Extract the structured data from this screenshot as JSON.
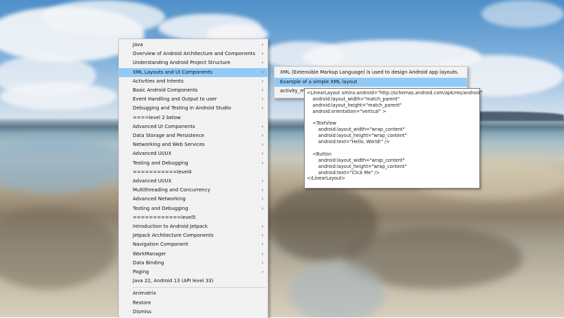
{
  "main_menu": {
    "items": [
      {
        "label": "Java",
        "arrow": true
      },
      {
        "label": "Overview of Android Architecture and Components",
        "arrow": true
      },
      {
        "label": "Understanding Android Project Structure",
        "arrow": true
      },
      {
        "label": "XML Layouts and UI Components",
        "arrow": true,
        "highlighted": true
      },
      {
        "label": "Activities and Intents",
        "arrow": true
      },
      {
        "label": "Basic Android Components",
        "arrow": true
      },
      {
        "label": "Event Handling and Output to user",
        "arrow": true
      },
      {
        "label": "Debugging and Testing in Android Studio",
        "arrow": true
      },
      {
        "label": "====level 2 below",
        "arrow": false
      },
      {
        "label": "Advanced UI Components",
        "arrow": true
      },
      {
        "label": "Data Storage and Persistence",
        "arrow": true
      },
      {
        "label": "Networking and Web Services",
        "arrow": true
      },
      {
        "label": "Advanced UI/UX",
        "arrow": true
      },
      {
        "label": "Testing and Debugging",
        "arrow": true
      },
      {
        "label": "===========level4",
        "arrow": false
      },
      {
        "label": "Advanced UI/UX",
        "arrow": true
      },
      {
        "label": "Multithreading and Concurrency",
        "arrow": true
      },
      {
        "label": "Advanced Networking",
        "arrow": true
      },
      {
        "label": "Testing and Debugging",
        "arrow": true
      },
      {
        "label": "============level5",
        "arrow": false
      },
      {
        "label": "Introduction to Android Jetpack",
        "arrow": true
      },
      {
        "label": "Jetpack Architecture Components",
        "arrow": true
      },
      {
        "label": "Navigation Component",
        "arrow": true
      },
      {
        "label": "WorkManager",
        "arrow": true
      },
      {
        "label": "Data Binding",
        "arrow": true
      },
      {
        "label": "Paging",
        "arrow": true
      },
      {
        "label": "Java 22, Android 13 (API level 33)",
        "arrow": false
      }
    ],
    "footer_items": [
      {
        "label": "Animatrix"
      },
      {
        "label": "Restore"
      },
      {
        "label": "Dismiss"
      }
    ]
  },
  "sub_menu": {
    "items": [
      {
        "label": "XML (Extensible Markup Language) is used to design Android app layouts.",
        "highlighted": false
      },
      {
        "label": "Example of a simple XML layout",
        "highlighted": true
      },
      {
        "label": "activity_ma",
        "highlighted": false
      }
    ]
  },
  "tooltip": {
    "lines": [
      "<LinearLayout xmlns:android=\"http://schemas.android.com/apk/res/android\"",
      "    android:layout_width=\"match_parent\"",
      "    android:layout_height=\"match_parent\"",
      "    android:orientation=\"vertical\" >",
      "",
      "    <TextView",
      "        android:layout_width=\"wrap_content\"",
      "        android:layout_height=\"wrap_content\"",
      "        android:text=\"Hello, World!\" />",
      "",
      "    <Button",
      "        android:layout_width=\"wrap_content\"",
      "        android:layout_height=\"wrap_content\"",
      "        android:text=\"Click Me\" />",
      "</LinearLayout>"
    ]
  },
  "icons": {
    "submenu_arrow": "chevron-right-icon"
  }
}
